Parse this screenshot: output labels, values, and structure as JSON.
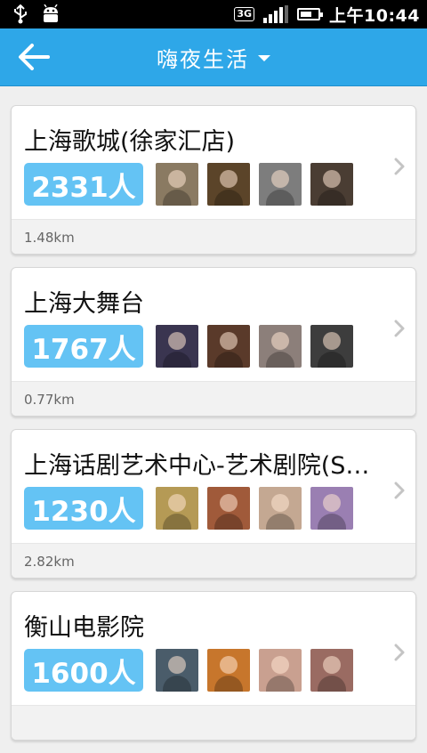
{
  "status_bar": {
    "icons": [
      "usb-icon",
      "android-debug-icon"
    ],
    "network": "3G",
    "time": "上午10:44",
    "battery_level": 0.75,
    "signal_bars": 4
  },
  "header": {
    "title": "嗨夜生活",
    "back_icon": "arrow-left-icon",
    "dropdown_icon": "triangle-down-icon",
    "background_color": "#2ea7e8"
  },
  "venues": [
    {
      "name": "上海歌城(徐家汇店)",
      "count": "2331人",
      "distance": "1.48km",
      "avatars": [
        {
          "color": "#8a7a62"
        },
        {
          "color": "#5b4429"
        },
        {
          "color": "#7d7d7d"
        },
        {
          "color": "#4a3d33"
        }
      ]
    },
    {
      "name": "上海大舞台",
      "count": "1767人",
      "distance": "0.77km",
      "avatars": [
        {
          "color": "#3a3550"
        },
        {
          "color": "#5a3a2a"
        },
        {
          "color": "#8c7f7a"
        },
        {
          "color": "#3d3d3d"
        }
      ]
    },
    {
      "name": "上海话剧艺术中心-艺术剧院(S…",
      "count": "1230人",
      "distance": "2.82km",
      "avatars": [
        {
          "color": "#b59a55"
        },
        {
          "color": "#a05a3a"
        },
        {
          "color": "#c4a892"
        },
        {
          "color": "#9a7fb2"
        }
      ]
    },
    {
      "name": "衡山电影院",
      "count": "1600人",
      "distance": "",
      "avatars": [
        {
          "color": "#4a5c6a"
        },
        {
          "color": "#c7762c"
        },
        {
          "color": "#c9a090"
        },
        {
          "color": "#9a6b62"
        }
      ]
    }
  ],
  "colors": {
    "badge": "#64c3f4",
    "chevron": "#c4c4c4",
    "page_background": "#efefef"
  }
}
